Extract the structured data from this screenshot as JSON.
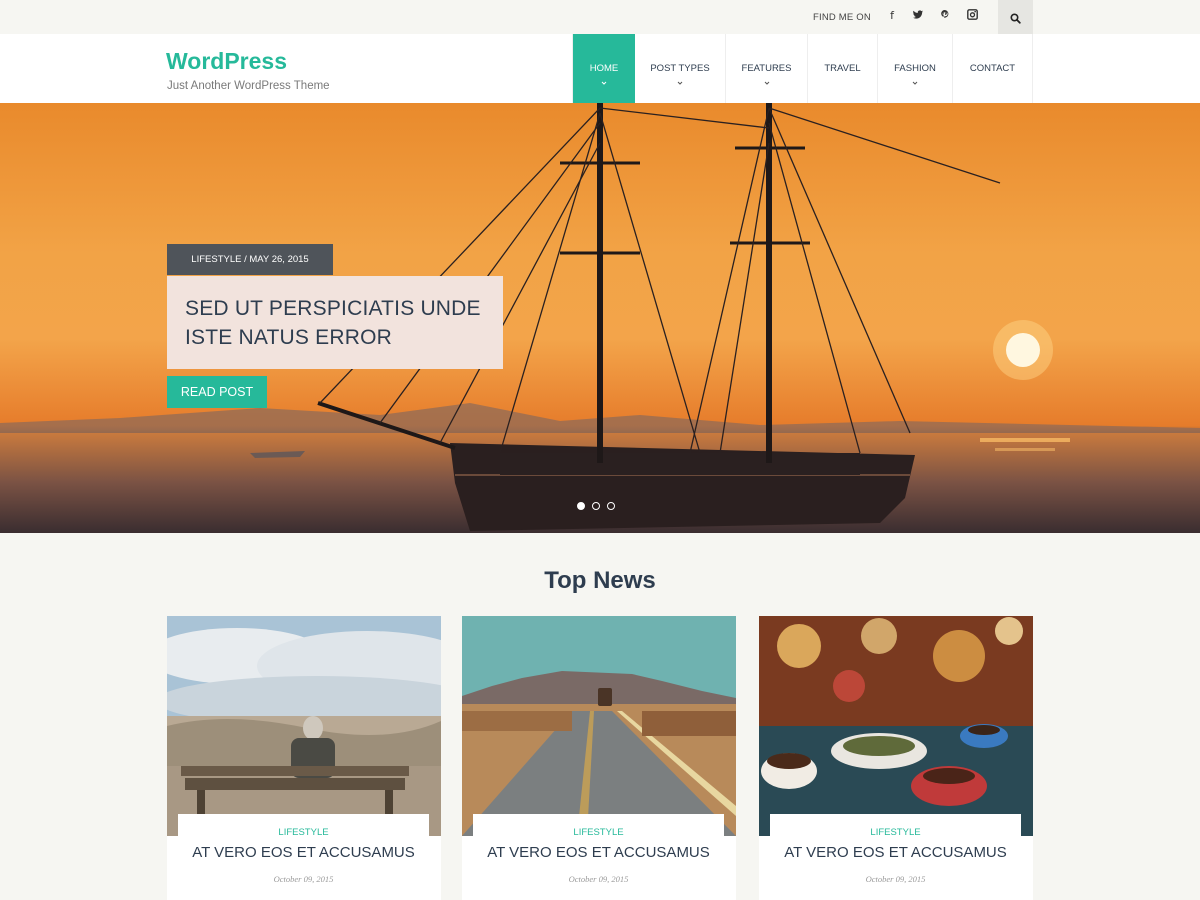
{
  "topbar": {
    "find_me_label": "FIND ME ON",
    "social_icons": [
      "facebook-icon",
      "twitter-icon",
      "pinterest-icon",
      "instagram-icon"
    ],
    "social_glyphs": [
      "f",
      "t",
      "p",
      "◙"
    ],
    "search_icon": "search-icon"
  },
  "header": {
    "site_title": "WordPress",
    "site_description": "Just Another WordPress Theme",
    "nav": [
      {
        "label": "HOME",
        "active": true,
        "dropdown": true
      },
      {
        "label": "POST TYPES",
        "active": false,
        "dropdown": true
      },
      {
        "label": "FEATURES",
        "active": false,
        "dropdown": true
      },
      {
        "label": "TRAVEL",
        "active": false,
        "dropdown": false
      },
      {
        "label": "FASHION",
        "active": false,
        "dropdown": true
      },
      {
        "label": "CONTACT",
        "active": false,
        "dropdown": false
      }
    ]
  },
  "hero": {
    "meta": "LIFESTYLE / MAY 26, 2015",
    "title": "SED UT PERSPICIATIS UNDE ISTE NATUS ERROR",
    "button_label": "READ POST",
    "slide_count": 3,
    "active_slide": 1
  },
  "top_news": {
    "heading": "Top News",
    "cards": [
      {
        "category": "LIFESTYLE",
        "title": "AT VERO EOS ET ACCUSAMUS",
        "date": "October 09, 2015"
      },
      {
        "category": "LIFESTYLE",
        "title": "AT VERO EOS ET ACCUSAMUS",
        "date": "October 09, 2015"
      },
      {
        "category": "LIFESTYLE",
        "title": "AT VERO EOS ET ACCUSAMUS",
        "date": "October 09, 2015"
      }
    ]
  },
  "colors": {
    "accent": "#26b99a",
    "dark_text": "#2e3d4f",
    "meta_bg": "#4f545a",
    "title_box_bg": "#f2e3dd"
  }
}
